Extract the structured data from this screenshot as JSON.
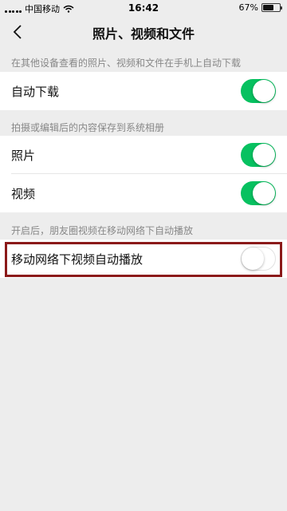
{
  "status_bar": {
    "carrier": "中国移动",
    "time": "16:42",
    "battery_text": "67%",
    "battery_level": 0.67
  },
  "nav": {
    "title": "照片、视频和文件",
    "back_icon": "chevron-left-icon"
  },
  "sections": {
    "auto_download_note": "在其他设备查看的照片、视频和文件在手机上自动下载",
    "save_to_album_note": "拍摄或编辑后的内容保存到系统相册",
    "autoplay_note": "开启后，朋友圈视频在移动网络下自动播放"
  },
  "rows": {
    "auto_download": {
      "label": "自动下载",
      "on": true
    },
    "photos": {
      "label": "照片",
      "on": true
    },
    "videos": {
      "label": "视频",
      "on": true
    },
    "mobile_autoplay": {
      "label": "移动网络下视频自动播放",
      "on": false
    }
  },
  "colors": {
    "toggle_on": "#07c160",
    "highlight_border": "#8b1a1a",
    "background": "#ededed"
  }
}
